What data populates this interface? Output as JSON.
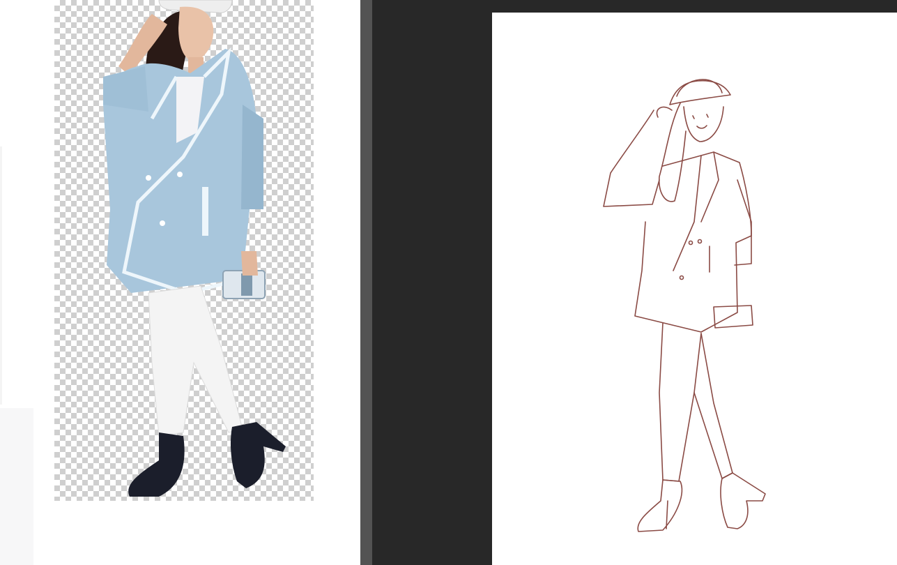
{
  "reference_panel": {
    "name": "reference-photo",
    "background": "#ffffff",
    "transparency_grid": {
      "light": "#ffffff",
      "dark": "#cfcfcf"
    },
    "subject_colors": {
      "coat": "#a8c6dc",
      "coat_shadow": "#8fb1c9",
      "trim": "#eef6fb",
      "pants": "#f4f4f4",
      "shoes": "#1b1e2b",
      "hair": "#2a1a16",
      "skin": "#e9c2a8",
      "hat": "#f2f2f2"
    }
  },
  "workspace": {
    "splitter_color": "#535353",
    "pasteboard_color": "#282828",
    "canvas_color": "#ffffff"
  },
  "sketch": {
    "line_color": "#8a4a44"
  }
}
